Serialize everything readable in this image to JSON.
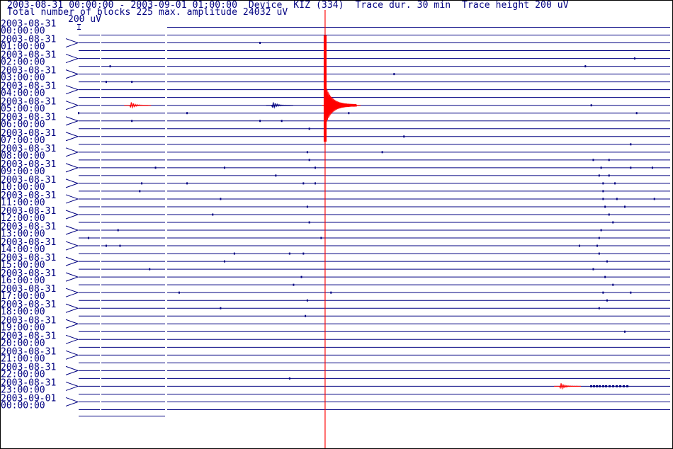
{
  "header": {
    "line1": "2003-08-31 00:00:00 - 2003-09-01 01:00:00  Device  KIZ (334)  Trace dur. 30 min  Trace height 200 uV",
    "line2": "Total number of blocks 225 max. amplitude 24032 uV"
  },
  "scale_label": "200 uV",
  "colors": {
    "trace": "#000080",
    "event": "#ff0000",
    "frame": "#000000",
    "background": "#ffffff"
  },
  "chart_data": {
    "type": "line",
    "trace_duration_min": 30,
    "trace_height_uV": 200,
    "max_amplitude_uV": 24032,
    "hour_labels": [
      {
        "date": "2003-08-31",
        "time": "00:00:00"
      },
      {
        "date": "2003-08-31",
        "time": "01:00:00"
      },
      {
        "date": "2003-08-31",
        "time": "02:00:00"
      },
      {
        "date": "2003-08-31",
        "time": "03:00:00"
      },
      {
        "date": "2003-08-31",
        "time": "04:00:00"
      },
      {
        "date": "2003-08-31",
        "time": "05:00:00"
      },
      {
        "date": "2003-08-31",
        "time": "06:00:00"
      },
      {
        "date": "2003-08-31",
        "time": "07:00:00"
      },
      {
        "date": "2003-08-31",
        "time": "08:00:00"
      },
      {
        "date": "2003-08-31",
        "time": "09:00:00"
      },
      {
        "date": "2003-08-31",
        "time": "10:00:00"
      },
      {
        "date": "2003-08-31",
        "time": "11:00:00"
      },
      {
        "date": "2003-08-31",
        "time": "12:00:00"
      },
      {
        "date": "2003-08-31",
        "time": "13:00:00"
      },
      {
        "date": "2003-08-31",
        "time": "14:00:00"
      },
      {
        "date": "2003-08-31",
        "time": "15:00:00"
      },
      {
        "date": "2003-08-31",
        "time": "16:00:00"
      },
      {
        "date": "2003-08-31",
        "time": "17:00:00"
      },
      {
        "date": "2003-08-31",
        "time": "18:00:00"
      },
      {
        "date": "2003-08-31",
        "time": "19:00:00"
      },
      {
        "date": "2003-08-31",
        "time": "20:00:00"
      },
      {
        "date": "2003-08-31",
        "time": "21:00:00"
      },
      {
        "date": "2003-08-31",
        "time": "22:00:00"
      },
      {
        "date": "2003-08-31",
        "time": "23:00:00"
      },
      {
        "date": "2003-09-01",
        "time": "00:00:00"
      }
    ],
    "events": [
      {
        "trace": 10,
        "minute": 3.1,
        "peak_uV": 900,
        "color": "red",
        "kind": "small"
      },
      {
        "trace": 10,
        "minute": 10.3,
        "peak_uV": 1000,
        "color": "blue",
        "kind": "small"
      },
      {
        "trace": 10,
        "minute": 12.5,
        "peak_uV": 24032,
        "color": "red",
        "kind": "main"
      },
      {
        "trace": 46,
        "minute": 24.9,
        "peak_uV": 1000,
        "color": "red",
        "kind": "small"
      }
    ],
    "spikes": [
      [
        2,
        9.2
      ],
      [
        4,
        28.2
      ],
      [
        5,
        1.6
      ],
      [
        5,
        25.7
      ],
      [
        6,
        16.0
      ],
      [
        7,
        1.4
      ],
      [
        7,
        2.7
      ],
      [
        10,
        26.0
      ],
      [
        11,
        0
      ],
      [
        11,
        5.5
      ],
      [
        11,
        13.7
      ],
      [
        11,
        28.3
      ],
      [
        12,
        2.7
      ],
      [
        12,
        9.2
      ],
      [
        12,
        10.3
      ],
      [
        12,
        30.5
      ],
      [
        12,
        32.2
      ],
      [
        13,
        11.7
      ],
      [
        13,
        30.6
      ],
      [
        14,
        16.5
      ],
      [
        14,
        32.0
      ],
      [
        15,
        28.0
      ],
      [
        15,
        30.6
      ],
      [
        16,
        11.6
      ],
      [
        16,
        15.4
      ],
      [
        16,
        30.7
      ],
      [
        17,
        11.7
      ],
      [
        17,
        26.1
      ],
      [
        17,
        26.9
      ],
      [
        18,
        3.9
      ],
      [
        18,
        7.4
      ],
      [
        18,
        12.0
      ],
      [
        18,
        26.5
      ],
      [
        18,
        28.0
      ],
      [
        18,
        29.1
      ],
      [
        19,
        10.0
      ],
      [
        19,
        26.4
      ],
      [
        19,
        26.9
      ],
      [
        20,
        3.2
      ],
      [
        20,
        5.5
      ],
      [
        20,
        11.4
      ],
      [
        20,
        12.0
      ],
      [
        20,
        26.6
      ],
      [
        20,
        27.2
      ],
      [
        21,
        3.1
      ],
      [
        21,
        26.6
      ],
      [
        22,
        7.2
      ],
      [
        22,
        26.6
      ],
      [
        22,
        27.3
      ],
      [
        22,
        29.2
      ],
      [
        23,
        11.6
      ],
      [
        23,
        26.7
      ],
      [
        23,
        27.7
      ],
      [
        24,
        6.8
      ],
      [
        24,
        26.9
      ],
      [
        24,
        34.3
      ],
      [
        25,
        11.7
      ],
      [
        25,
        27.1
      ],
      [
        25,
        34.0
      ],
      [
        26,
        2.0
      ],
      [
        26,
        26.5
      ],
      [
        27,
        0.5
      ],
      [
        27,
        12.3
      ],
      [
        27,
        26.4
      ],
      [
        28,
        1.4
      ],
      [
        28,
        2.1
      ],
      [
        28,
        25.4
      ],
      [
        28,
        26.3
      ],
      [
        29,
        7.9
      ],
      [
        29,
        10.7
      ],
      [
        29,
        11.4
      ],
      [
        29,
        26.4
      ],
      [
        30,
        7.4
      ],
      [
        30,
        26.8
      ],
      [
        31,
        3.6
      ],
      [
        31,
        26.1
      ],
      [
        32,
        11.3
      ],
      [
        32,
        26.7
      ],
      [
        33,
        10.9
      ],
      [
        33,
        27.1
      ],
      [
        34,
        5.1
      ],
      [
        34,
        12.8
      ],
      [
        34,
        26.6
      ],
      [
        34,
        28.0
      ],
      [
        35,
        11.6
      ],
      [
        35,
        26.8
      ],
      [
        36,
        7.2
      ],
      [
        36,
        26.4
      ],
      [
        37,
        11.5
      ],
      [
        39,
        27.7
      ],
      [
        45,
        10.7
      ]
    ]
  }
}
